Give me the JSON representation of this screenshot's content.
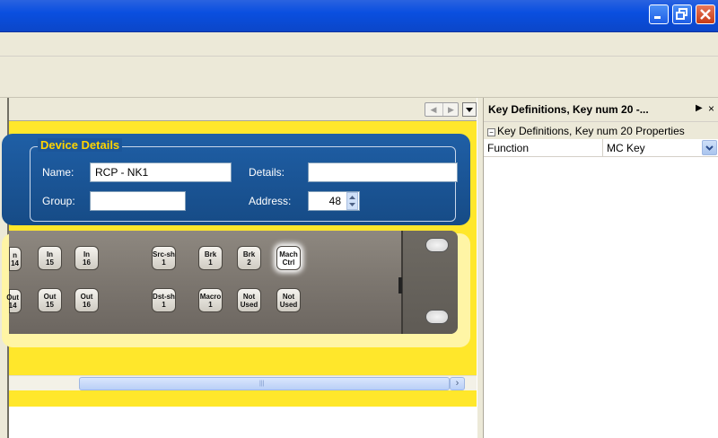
{
  "window": {
    "controls": [
      "minimize-icon",
      "restore-icon",
      "close-icon"
    ]
  },
  "document": {
    "device_details": {
      "legend": "Device Details",
      "name_label": "Name:",
      "name_value": "RCP - NK1",
      "details_label": "Details:",
      "details_value": "",
      "group_label": "Group:",
      "group_value": "",
      "address_label": "Address:",
      "address_value": "48"
    },
    "panel_keys": {
      "row1": [
        "n\n14",
        "In\n15",
        "In\n16",
        "Src-sh\n1",
        "Brk\n1",
        "Brk\n2",
        "Mach\nCtrl"
      ],
      "row2": [
        "Out\n14",
        "Out\n15",
        "Out\n16",
        "Dst-sh\n1",
        "Macro\n1",
        "Not\nUsed",
        "Not\nUsed"
      ]
    }
  },
  "properties": {
    "title": "Key Definitions, Key num 20 -...",
    "category": "Key Definitions, Key num 20 Properties",
    "rows": [
      {
        "name": "Function",
        "value": "MC Key"
      }
    ]
  },
  "colors": {
    "titlebar": "#0a4fe0",
    "panel_blue": "#1f5fa6",
    "panel_yellow": "#ffe72b",
    "legend_text": "#ffd400"
  }
}
